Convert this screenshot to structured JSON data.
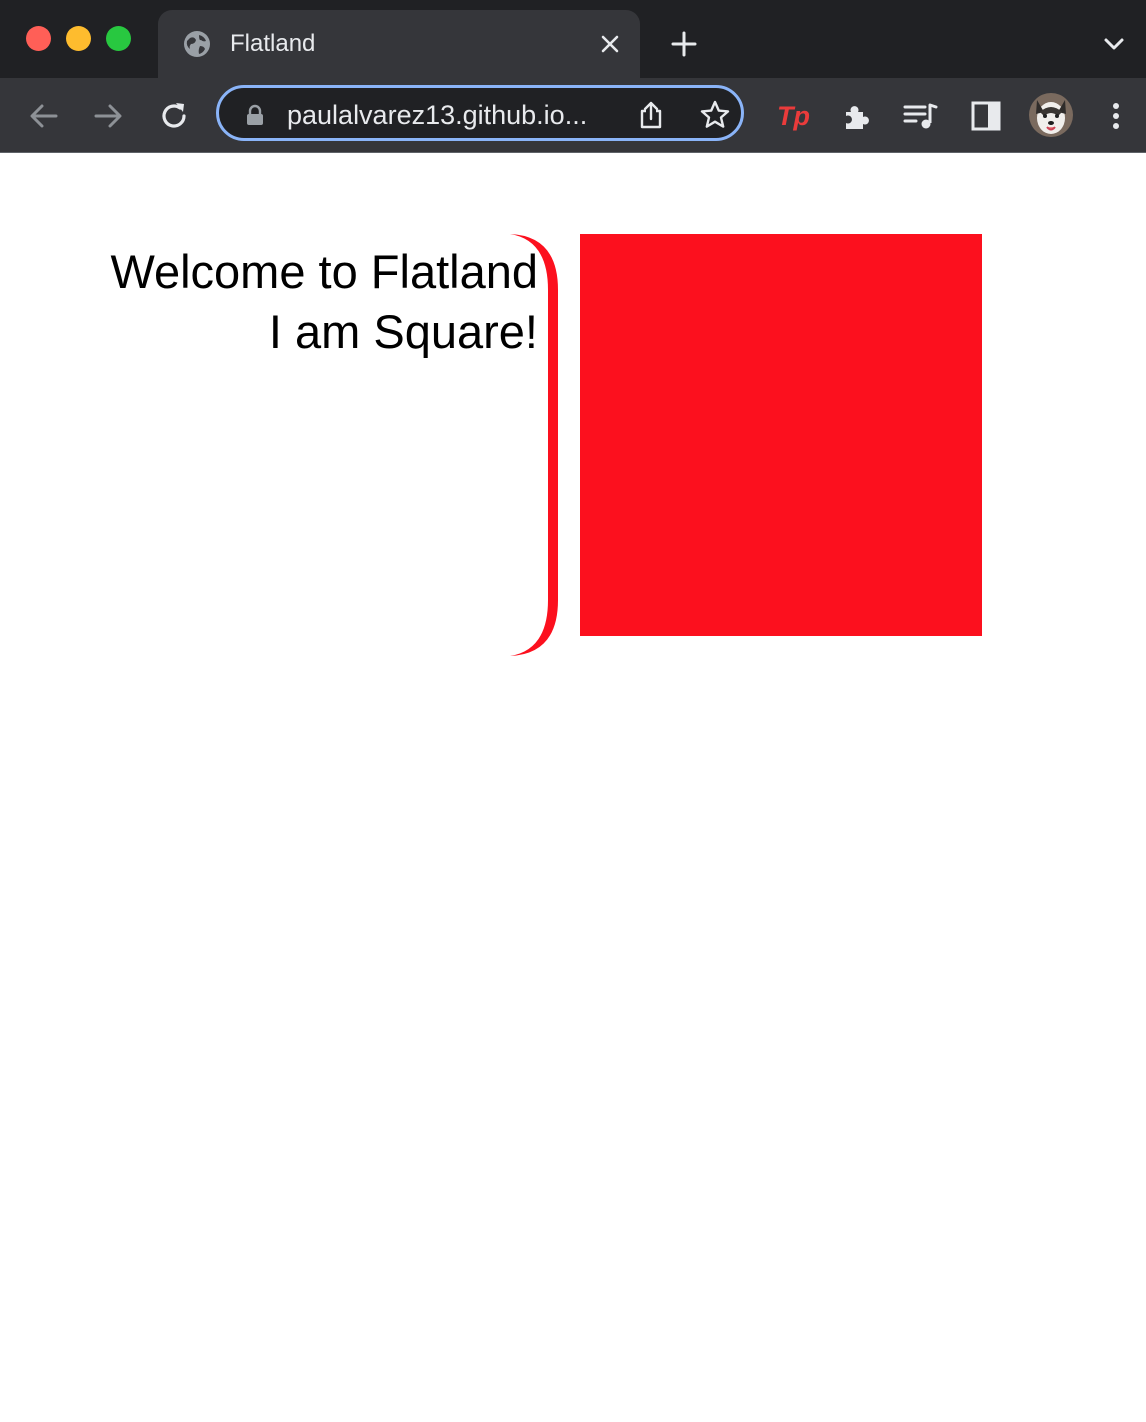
{
  "browser": {
    "tab": {
      "title": "Flatland"
    },
    "address_bar": {
      "url": "paulalvarez13.github.io..."
    },
    "extensions": {
      "tp_label": "Tp"
    }
  },
  "page": {
    "heading_line1": "Welcome to Flatland",
    "heading_line2": "I am Square!"
  },
  "colors": {
    "square": "#fc101e",
    "bracket": "#fc101e",
    "accent_blue": "#8ab4f8"
  },
  "icons": {
    "favicon": "globe-icon",
    "close": "close-icon",
    "new_tab": "plus-icon",
    "tab_search": "chevron-down-icon",
    "back": "back-arrow-icon",
    "forward": "forward-arrow-icon",
    "reload": "reload-icon",
    "lock": "lock-icon",
    "share": "share-icon",
    "bookmark": "star-icon",
    "extensions": "puzzle-icon",
    "media": "media-queue-icon",
    "side_panel": "side-panel-icon",
    "profile": "avatar",
    "menu": "kebab-menu-icon"
  }
}
